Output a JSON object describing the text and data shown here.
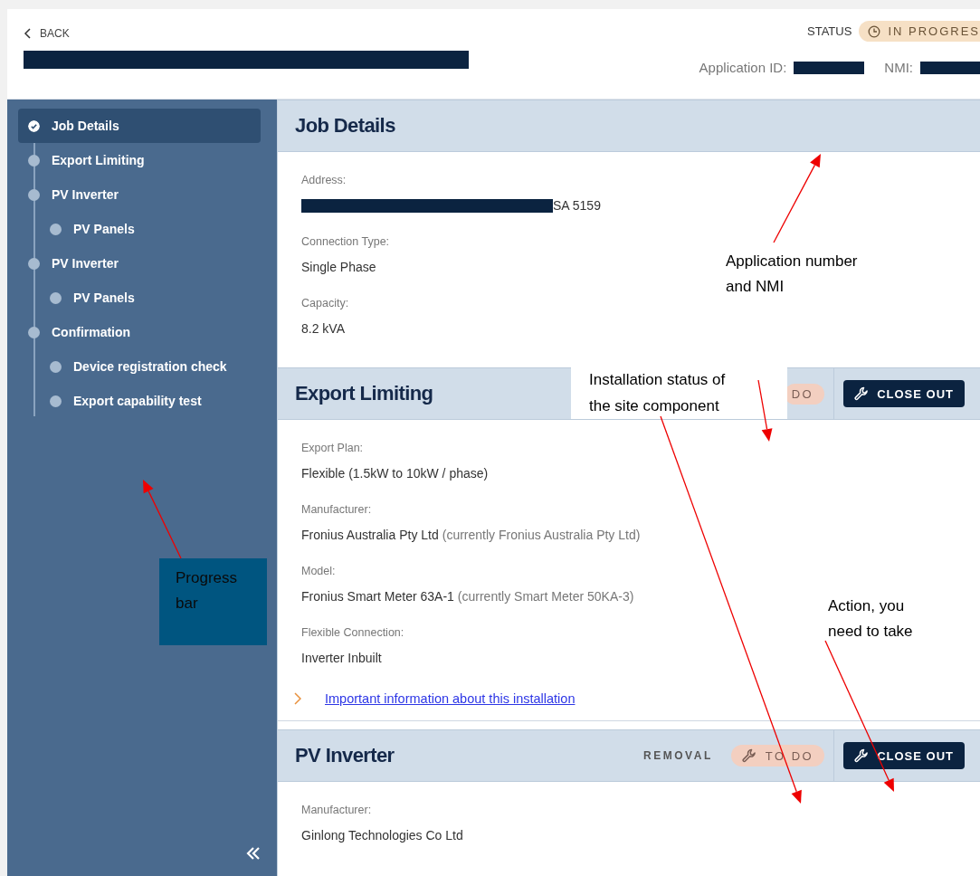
{
  "header": {
    "back": "BACK",
    "status_label": "STATUS",
    "status": "IN PROGRES",
    "application_id_label": "Application ID:",
    "nmi_label": "NMI:"
  },
  "sidebar": {
    "items": [
      {
        "label": "Job Details",
        "selected": true,
        "done": true
      },
      {
        "label": "Export Limiting",
        "selected": false,
        "done": false
      },
      {
        "label": "PV Inverter",
        "selected": false,
        "done": false,
        "children": [
          {
            "label": "PV Panels",
            "selected": false,
            "done": false
          }
        ]
      },
      {
        "label": "PV Inverter",
        "selected": false,
        "done": false,
        "children": [
          {
            "label": "PV Panels",
            "selected": false,
            "done": false
          }
        ]
      },
      {
        "label": "Confirmation",
        "selected": false,
        "done": false,
        "children": [
          {
            "label": "Device registration check",
            "selected": false,
            "done": false
          },
          {
            "label": "Export capability test",
            "selected": false,
            "done": false
          }
        ]
      }
    ]
  },
  "sections": [
    {
      "title": "Job Details",
      "fields": [
        {
          "label": "Address:",
          "value": "SA 5159",
          "redacted": true
        },
        {
          "label": "Connection Type:",
          "value": "Single Phase"
        },
        {
          "label": "Capacity:",
          "value": "8.2 kVA"
        }
      ]
    },
    {
      "title": "Export Limiting",
      "status": "DO",
      "status_icon": false,
      "action": "CLOSE OUT",
      "fields": [
        {
          "label": "Export Plan:",
          "value": "Flexible (1.5kW to 10kW / phase)"
        },
        {
          "label": "Manufacturer:",
          "value": "Fronius Australia Pty Ltd",
          "note": "(currently Fronius Australia Pty Ltd)"
        },
        {
          "label": "Model:",
          "value": "Fronius Smart Meter 63A-1",
          "note": "(currently Smart Meter 50KA-3)"
        },
        {
          "label": "Flexible Connection:",
          "value": "Inverter Inbuilt"
        }
      ],
      "link": "Important information about this installation"
    },
    {
      "title": "PV Inverter",
      "tag": "REMOVAL",
      "status": "TO DO",
      "status_icon": true,
      "action": "CLOSE OUT",
      "fields": [
        {
          "label": "Manufacturer:",
          "value": "Ginlong Technologies Co Ltd"
        }
      ]
    }
  ],
  "annotations": [
    {
      "kind": "plain",
      "lines": [
        "Application number",
        "and NMI"
      ]
    },
    {
      "kind": "boxed",
      "lines": [
        "Installation status of",
        "the site component"
      ]
    },
    {
      "kind": "filled",
      "lines": [
        "Progress",
        "bar"
      ]
    },
    {
      "kind": "plain",
      "lines": [
        "Action, you",
        "need to take"
      ]
    }
  ]
}
